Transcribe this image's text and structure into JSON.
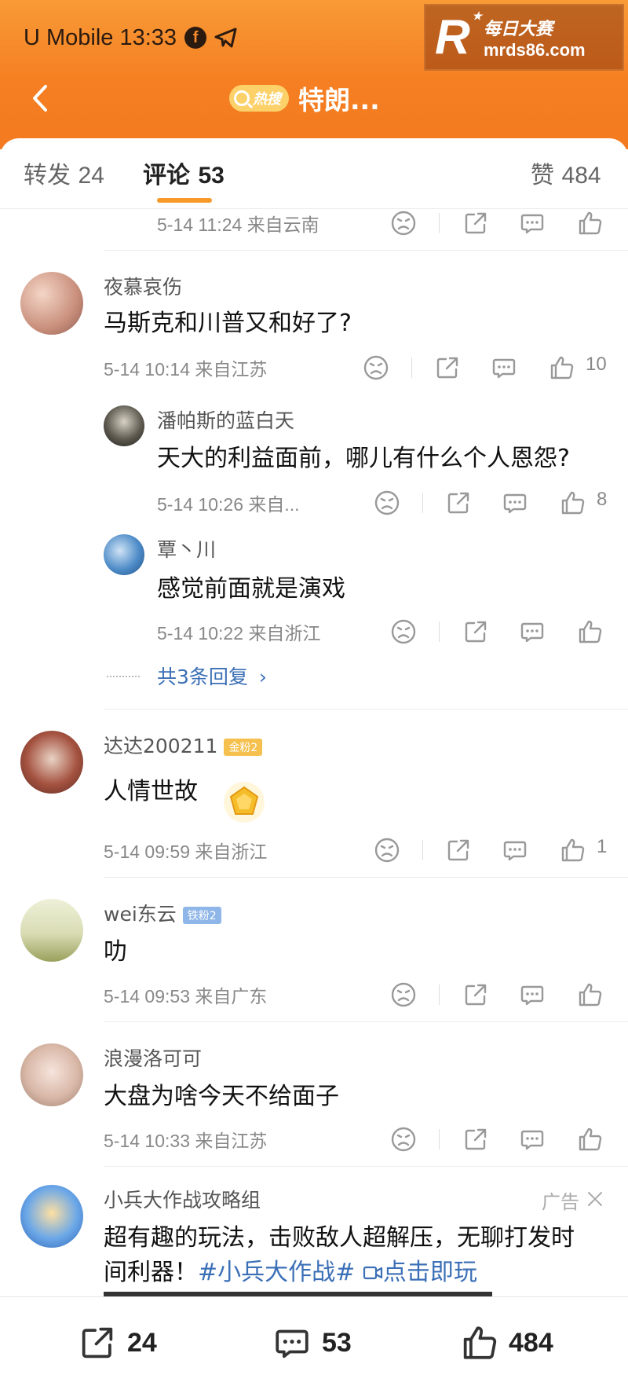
{
  "status_bar": {
    "carrier_time": "U Mobile 13:33",
    "facebook_icon": "f"
  },
  "watermark": {
    "logo": "R",
    "line1": "每日大赛",
    "line2": "mrds86.com"
  },
  "header": {
    "hot_badge": "热搜",
    "title": "特朗..."
  },
  "tabs": {
    "repost_label": "转发",
    "repost_count": "24",
    "comment_label": "评论",
    "comment_count": "53",
    "like_label": "赞",
    "like_count": "484"
  },
  "top_meta": "5-14 11:24 来自云南",
  "comments": [
    {
      "user": "夜慕哀伤",
      "text": "马斯克和川普又和好了?",
      "meta": "5-14 10:14 来自江苏",
      "likes": "10",
      "replies": [
        {
          "user": "潘帕斯的蓝白天",
          "text": "天大的利益面前，哪儿有什么个人恩怨?",
          "meta": "5-14 10:26 来自...",
          "likes": "8"
        },
        {
          "user": "覃丶川",
          "text": "感觉前面就是演戏",
          "meta": "5-14 10:22 来自浙江",
          "likes": ""
        }
      ],
      "more_replies": "共3条回复"
    },
    {
      "user": "达达200211",
      "badge": "金粉2",
      "text": "人情世故",
      "meta": "5-14 09:59 来自浙江",
      "likes": "1"
    },
    {
      "user": "wei东云",
      "badge": "铁粉2",
      "text": "叻",
      "meta": "5-14 09:53 来自广东",
      "likes": ""
    },
    {
      "user": "浪漫洛可可",
      "text": "大盘为啥今天不给面子",
      "meta": "5-14 10:33 来自江苏",
      "likes": ""
    }
  ],
  "ad": {
    "user": "小兵大作战攻略组",
    "label": "广告",
    "line1": "超有趣的玩法，击败敌人超解压，无聊打发时",
    "line2_prefix": "间利器！",
    "topic": "#小兵大作战#",
    "link": "点击即玩"
  },
  "bottom_bar": {
    "repost_count": "24",
    "comment_count": "53",
    "like_count": "484"
  },
  "colors": {
    "header_orange": "#f57f22",
    "accent_underline": "#f79a2a",
    "link_blue": "#3b6fb6"
  },
  "icons": [
    "back-arrow-icon",
    "search-icon",
    "facebook-icon",
    "telegram-icon",
    "sad-face-icon",
    "share-icon",
    "comment-icon",
    "thumbs-up-icon",
    "chevron-right-icon",
    "close-icon",
    "link-icon"
  ]
}
